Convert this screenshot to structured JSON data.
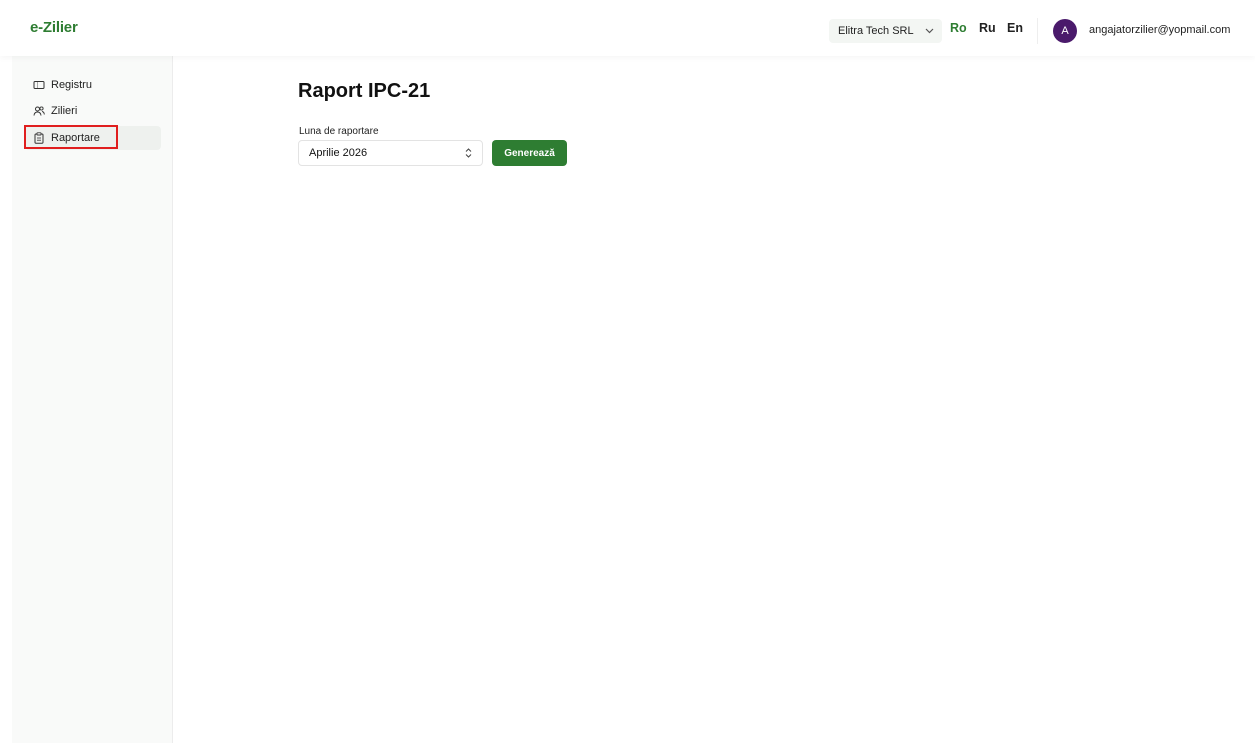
{
  "header": {
    "logo": "e-Zilier",
    "company": "Elitra Tech SRL",
    "languages": [
      "Ro",
      "Ru",
      "En"
    ],
    "active_language": "Ro",
    "avatar_initial": "A",
    "user_email": "angajatorzilier@yopmail.com"
  },
  "sidebar": {
    "items": [
      {
        "label": "Registru",
        "icon": "ticket-icon"
      },
      {
        "label": "Zilieri",
        "icon": "users-icon"
      },
      {
        "label": "Raportare",
        "icon": "clipboard-icon"
      }
    ],
    "active_item": "Raportare"
  },
  "main": {
    "title": "Raport IPC-21",
    "month_label": "Luna de raportare",
    "month_value": "Aprilie 2026",
    "generate_label": "Generează"
  },
  "colors": {
    "brand": "#2e7d32",
    "avatar": "#4a1a6b",
    "highlight": "#e01e1e"
  }
}
